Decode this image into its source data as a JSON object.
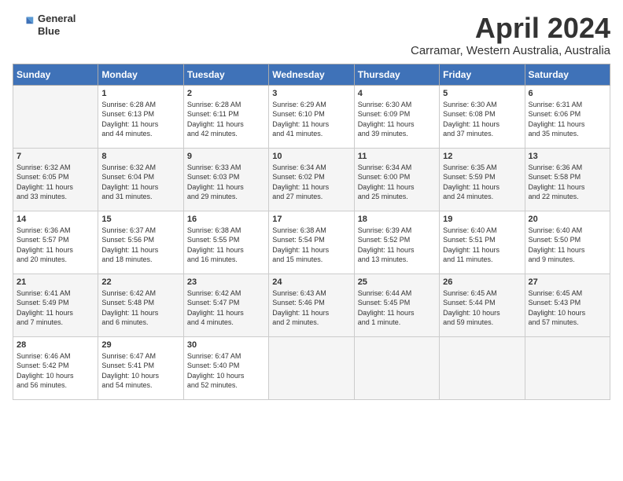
{
  "header": {
    "logo_line1": "General",
    "logo_line2": "Blue",
    "month": "April 2024",
    "location": "Carramar, Western Australia, Australia"
  },
  "days_of_week": [
    "Sunday",
    "Monday",
    "Tuesday",
    "Wednesday",
    "Thursday",
    "Friday",
    "Saturday"
  ],
  "weeks": [
    [
      {
        "day": "",
        "content": ""
      },
      {
        "day": "1",
        "content": "Sunrise: 6:28 AM\nSunset: 6:13 PM\nDaylight: 11 hours\nand 44 minutes."
      },
      {
        "day": "2",
        "content": "Sunrise: 6:28 AM\nSunset: 6:11 PM\nDaylight: 11 hours\nand 42 minutes."
      },
      {
        "day": "3",
        "content": "Sunrise: 6:29 AM\nSunset: 6:10 PM\nDaylight: 11 hours\nand 41 minutes."
      },
      {
        "day": "4",
        "content": "Sunrise: 6:30 AM\nSunset: 6:09 PM\nDaylight: 11 hours\nand 39 minutes."
      },
      {
        "day": "5",
        "content": "Sunrise: 6:30 AM\nSunset: 6:08 PM\nDaylight: 11 hours\nand 37 minutes."
      },
      {
        "day": "6",
        "content": "Sunrise: 6:31 AM\nSunset: 6:06 PM\nDaylight: 11 hours\nand 35 minutes."
      }
    ],
    [
      {
        "day": "7",
        "content": "Sunrise: 6:32 AM\nSunset: 6:05 PM\nDaylight: 11 hours\nand 33 minutes."
      },
      {
        "day": "8",
        "content": "Sunrise: 6:32 AM\nSunset: 6:04 PM\nDaylight: 11 hours\nand 31 minutes."
      },
      {
        "day": "9",
        "content": "Sunrise: 6:33 AM\nSunset: 6:03 PM\nDaylight: 11 hours\nand 29 minutes."
      },
      {
        "day": "10",
        "content": "Sunrise: 6:34 AM\nSunset: 6:02 PM\nDaylight: 11 hours\nand 27 minutes."
      },
      {
        "day": "11",
        "content": "Sunrise: 6:34 AM\nSunset: 6:00 PM\nDaylight: 11 hours\nand 25 minutes."
      },
      {
        "day": "12",
        "content": "Sunrise: 6:35 AM\nSunset: 5:59 PM\nDaylight: 11 hours\nand 24 minutes."
      },
      {
        "day": "13",
        "content": "Sunrise: 6:36 AM\nSunset: 5:58 PM\nDaylight: 11 hours\nand 22 minutes."
      }
    ],
    [
      {
        "day": "14",
        "content": "Sunrise: 6:36 AM\nSunset: 5:57 PM\nDaylight: 11 hours\nand 20 minutes."
      },
      {
        "day": "15",
        "content": "Sunrise: 6:37 AM\nSunset: 5:56 PM\nDaylight: 11 hours\nand 18 minutes."
      },
      {
        "day": "16",
        "content": "Sunrise: 6:38 AM\nSunset: 5:55 PM\nDaylight: 11 hours\nand 16 minutes."
      },
      {
        "day": "17",
        "content": "Sunrise: 6:38 AM\nSunset: 5:54 PM\nDaylight: 11 hours\nand 15 minutes."
      },
      {
        "day": "18",
        "content": "Sunrise: 6:39 AM\nSunset: 5:52 PM\nDaylight: 11 hours\nand 13 minutes."
      },
      {
        "day": "19",
        "content": "Sunrise: 6:40 AM\nSunset: 5:51 PM\nDaylight: 11 hours\nand 11 minutes."
      },
      {
        "day": "20",
        "content": "Sunrise: 6:40 AM\nSunset: 5:50 PM\nDaylight: 11 hours\nand 9 minutes."
      }
    ],
    [
      {
        "day": "21",
        "content": "Sunrise: 6:41 AM\nSunset: 5:49 PM\nDaylight: 11 hours\nand 7 minutes."
      },
      {
        "day": "22",
        "content": "Sunrise: 6:42 AM\nSunset: 5:48 PM\nDaylight: 11 hours\nand 6 minutes."
      },
      {
        "day": "23",
        "content": "Sunrise: 6:42 AM\nSunset: 5:47 PM\nDaylight: 11 hours\nand 4 minutes."
      },
      {
        "day": "24",
        "content": "Sunrise: 6:43 AM\nSunset: 5:46 PM\nDaylight: 11 hours\nand 2 minutes."
      },
      {
        "day": "25",
        "content": "Sunrise: 6:44 AM\nSunset: 5:45 PM\nDaylight: 11 hours\nand 1 minute."
      },
      {
        "day": "26",
        "content": "Sunrise: 6:45 AM\nSunset: 5:44 PM\nDaylight: 10 hours\nand 59 minutes."
      },
      {
        "day": "27",
        "content": "Sunrise: 6:45 AM\nSunset: 5:43 PM\nDaylight: 10 hours\nand 57 minutes."
      }
    ],
    [
      {
        "day": "28",
        "content": "Sunrise: 6:46 AM\nSunset: 5:42 PM\nDaylight: 10 hours\nand 56 minutes."
      },
      {
        "day": "29",
        "content": "Sunrise: 6:47 AM\nSunset: 5:41 PM\nDaylight: 10 hours\nand 54 minutes."
      },
      {
        "day": "30",
        "content": "Sunrise: 6:47 AM\nSunset: 5:40 PM\nDaylight: 10 hours\nand 52 minutes."
      },
      {
        "day": "",
        "content": ""
      },
      {
        "day": "",
        "content": ""
      },
      {
        "day": "",
        "content": ""
      },
      {
        "day": "",
        "content": ""
      }
    ]
  ]
}
